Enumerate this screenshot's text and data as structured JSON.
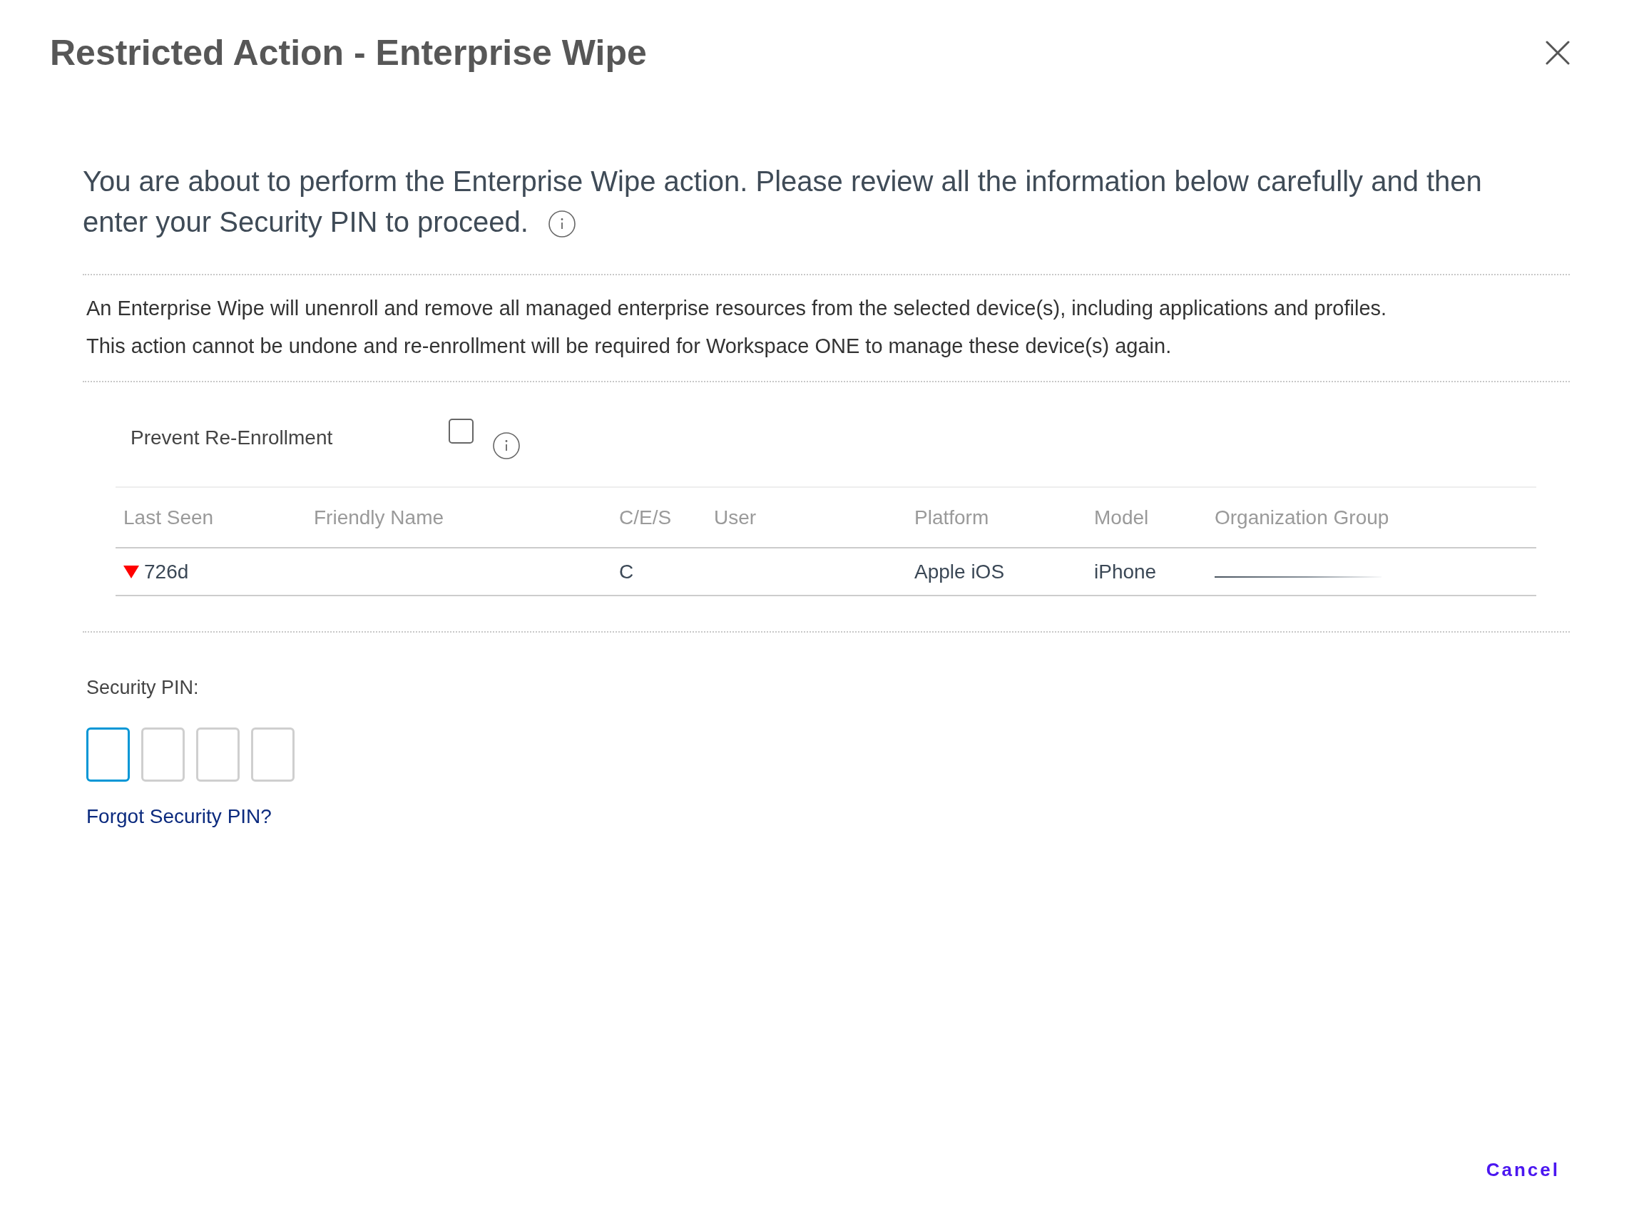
{
  "dialog": {
    "title": "Restricted Action - Enterprise Wipe"
  },
  "intro": [
    "You are about to perform the Enterprise Wipe action. Please review all the information below carefully and then",
    "enter your Security PIN to proceed."
  ],
  "description": [
    "An Enterprise Wipe will unenroll and remove all managed enterprise resources from the selected device(s), including applications and profiles.",
    "This action cannot be undone and re-enrollment will be required for Workspace ONE to manage these device(s) again."
  ],
  "prevent_reenrollment": {
    "label": "Prevent Re-Enrollment",
    "checked": false
  },
  "table": {
    "columns": [
      "Last Seen",
      "Friendly Name",
      "C/E/S",
      "User",
      "Platform",
      "Model",
      "Organization Group"
    ],
    "rows": [
      {
        "last_seen": "726d",
        "stale": true,
        "ces": "C",
        "platform": "Apple iOS",
        "model": "iPhone",
        "organization_group_redacted": true
      }
    ]
  },
  "security_pin": {
    "label": "Security PIN:",
    "digits": [
      {
        "focused": true
      },
      {
        "focused": false
      },
      {
        "focused": false
      },
      {
        "focused": false
      }
    ],
    "forgot_link": "Forgot Security PIN?"
  },
  "footer": {
    "cancel_button": "Cancel"
  }
}
